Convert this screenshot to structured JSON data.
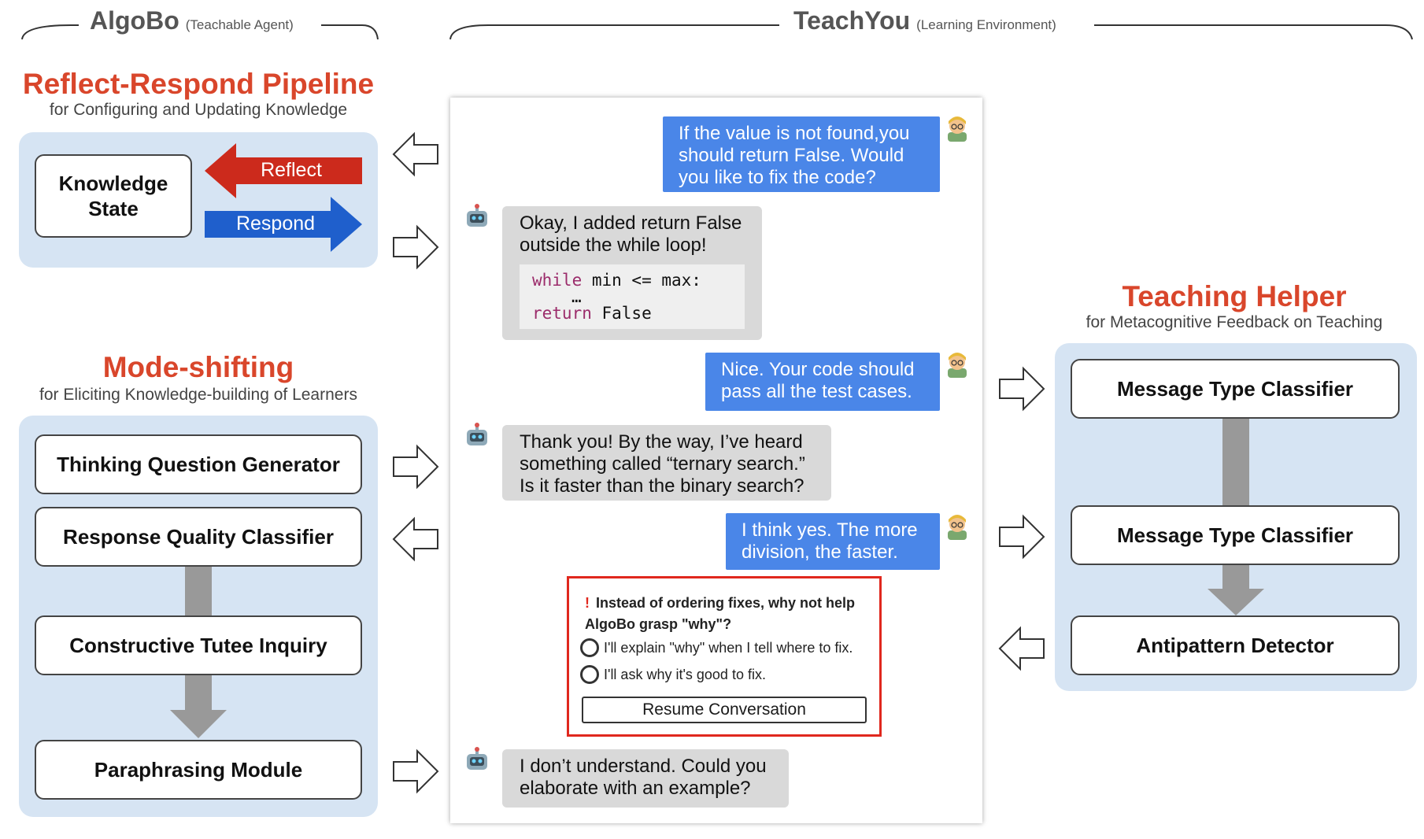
{
  "header": {
    "left_title": "AlgoBo",
    "left_sub": "(Teachable Agent)",
    "center_title": "TeachYou",
    "center_sub": "(Learning Environment)"
  },
  "reflect_respond": {
    "title": "Reflect-Respond Pipeline",
    "subtitle": "for Configuring and Updating Knowledge",
    "knowledge_state": "Knowledge State",
    "reflect": "Reflect",
    "respond": "Respond",
    "reflect_color": "#cc2a1c",
    "respond_color": "#1f5fcc"
  },
  "mode_shifting": {
    "title": "Mode-shifting",
    "subtitle": "for Eliciting Knowledge-building of Learners",
    "boxes": [
      "Thinking Question Generator",
      "Response Quality Classifier",
      "Constructive Tutee Inquiry",
      "Paraphrasing Module"
    ]
  },
  "teaching_helper": {
    "title": "Teaching Helper",
    "subtitle": "for Metacognitive Feedback on Teaching",
    "boxes": [
      "Message Type Classifier",
      "Message Type Classifier",
      "Antipattern Detector"
    ]
  },
  "chat": {
    "msg1": "If the value is not found,you should return False. Would you like to fix the code?",
    "msg2": "Okay, I added return False outside the while loop!",
    "code_line1_kw": "while",
    "code_line1_rest": " min <= max:",
    "code_line2": "…",
    "code_line3_kw": "return",
    "code_line3_rest": " False",
    "msg3": "Nice. Your code should pass all the test cases.",
    "msg4": "Thank you! By the way, I’ve heard something called “ternary search.” Is it faster than the binary search?",
    "msg5": "I think yes. The more division, the faster.",
    "msg6": "I don’t understand. Could you elaborate with an example?"
  },
  "popup": {
    "mark": "!",
    "question": "Instead of ordering fixes, why not help AlgoBo grasp \"why\"?",
    "option1": "I'll explain \"why\" when I tell where to fix.",
    "option2": "I'll ask why it's good to fix.",
    "button": "Resume Conversation"
  },
  "colors": {
    "accent_title": "#d9462b",
    "panel": "#d6e4f3",
    "user_bubble": "#4a86e8",
    "bot_bubble": "#d9d9d9",
    "popup_border": "#e0281e"
  },
  "icons": [
    "teacher-avatar-icon",
    "robot-avatar-icon",
    "hollow-arrow-left-icon",
    "hollow-arrow-right-icon"
  ]
}
